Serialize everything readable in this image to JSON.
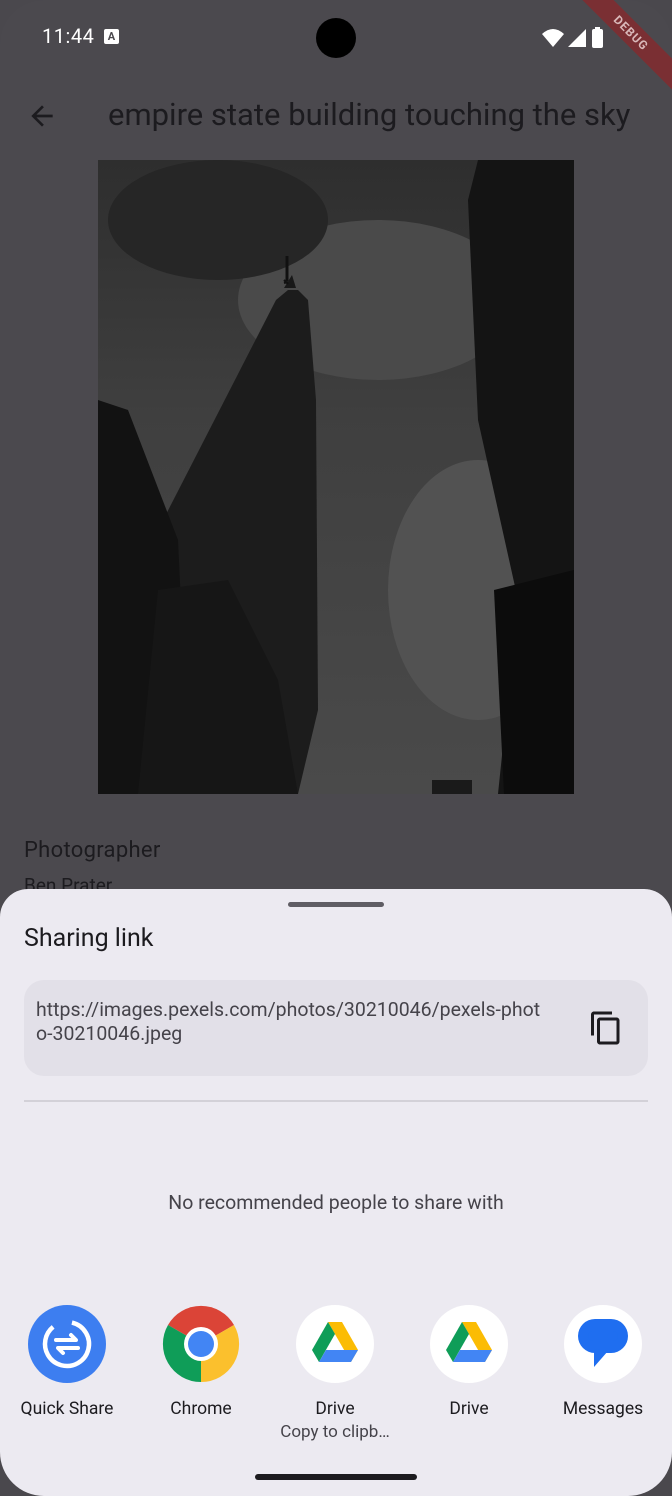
{
  "status_bar": {
    "time": "11:44",
    "notification_badge": "A",
    "debug_label": "DEBUG"
  },
  "app_bar": {
    "title": "empire  state building touching the sky",
    "back_icon": "arrow-back-icon"
  },
  "photo_details": {
    "photographer_label": "Photographer",
    "photographer_name": "Ben Prater"
  },
  "share_sheet": {
    "title": "Sharing link",
    "link": "https://images.pexels.com/photos/30210046/pexels-photo-30210046.jpeg",
    "copy_icon": "copy-icon",
    "no_people_text": "No recommended people to share with",
    "apps": [
      {
        "label": "Quick Share",
        "sub": "",
        "icon": "quick-share-icon"
      },
      {
        "label": "Chrome",
        "sub": "",
        "icon": "chrome-icon"
      },
      {
        "label": "Drive",
        "sub": "Copy to clipb…",
        "icon": "drive-icon"
      },
      {
        "label": "Drive",
        "sub": "",
        "icon": "drive-icon"
      },
      {
        "label": "Messages",
        "sub": "",
        "icon": "messages-icon"
      }
    ]
  },
  "colors": {
    "scrim": "#4b494e",
    "sheet_bg": "#eceaf1",
    "link_box": "#e2e0e8",
    "quick_share_blue": "#3d7ef0",
    "messages_blue": "#1f6ef0"
  }
}
